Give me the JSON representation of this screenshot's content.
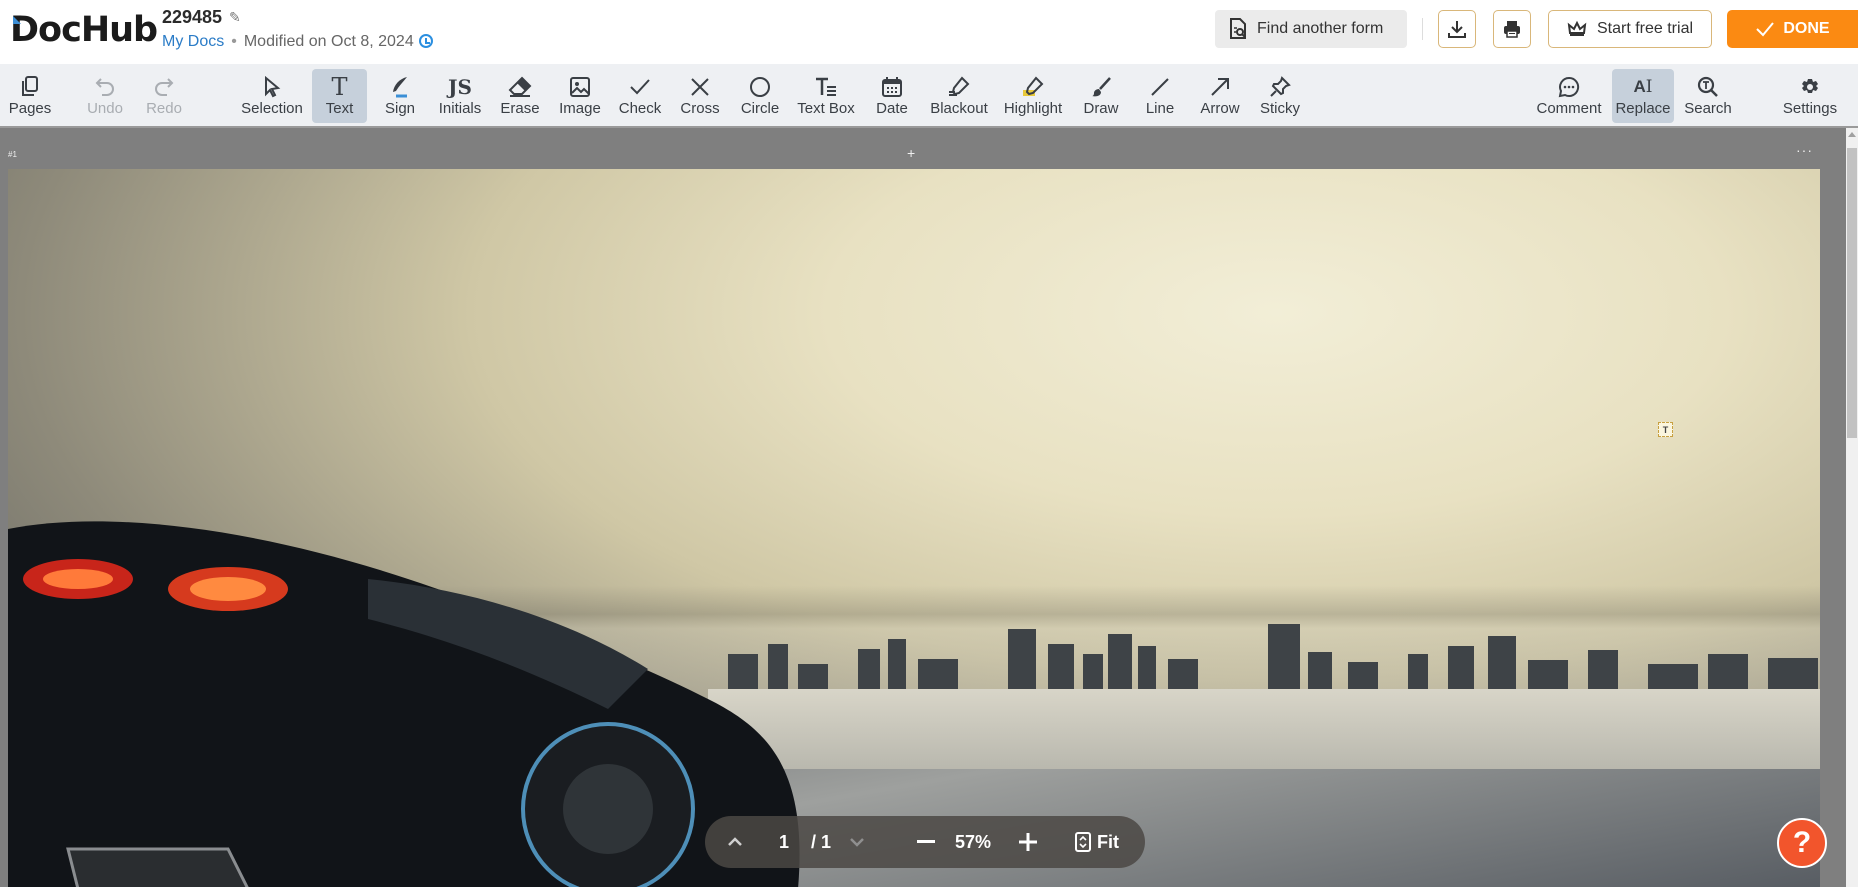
{
  "header": {
    "logo": "DocHub",
    "doc_title": "229485",
    "breadcrumb_link": "My Docs",
    "separator": "•",
    "modified": "Modified on Oct 8, 2024",
    "find_form": "Find another form",
    "start_trial": "Start free trial",
    "done": "DONE"
  },
  "toolbar": {
    "left": [
      {
        "id": "pages",
        "label": "Pages",
        "icon": "pages-icon"
      },
      {
        "id": "undo",
        "label": "Undo",
        "icon": "undo-icon",
        "disabled": true
      },
      {
        "id": "redo",
        "label": "Redo",
        "icon": "redo-icon",
        "disabled": true
      }
    ],
    "tools": [
      {
        "id": "selection",
        "label": "Selection",
        "icon": "cursor-icon"
      },
      {
        "id": "text",
        "label": "Text",
        "icon": "text-icon",
        "active": true
      },
      {
        "id": "sign",
        "label": "Sign",
        "icon": "quill-icon"
      },
      {
        "id": "initials",
        "label": "Initials",
        "icon": "initials-icon"
      },
      {
        "id": "erase",
        "label": "Erase",
        "icon": "eraser-icon"
      },
      {
        "id": "image",
        "label": "Image",
        "icon": "image-icon"
      },
      {
        "id": "check",
        "label": "Check",
        "icon": "check-icon"
      },
      {
        "id": "cross",
        "label": "Cross",
        "icon": "cross-icon"
      },
      {
        "id": "circle",
        "label": "Circle",
        "icon": "circle-icon"
      },
      {
        "id": "textbox",
        "label": "Text Box",
        "icon": "textbox-icon"
      },
      {
        "id": "date",
        "label": "Date",
        "icon": "calendar-icon"
      },
      {
        "id": "blackout",
        "label": "Blackout",
        "icon": "blackout-icon"
      },
      {
        "id": "highlight",
        "label": "Highlight",
        "icon": "highlighter-icon"
      },
      {
        "id": "draw",
        "label": "Draw",
        "icon": "brush-icon"
      },
      {
        "id": "line",
        "label": "Line",
        "icon": "line-icon"
      },
      {
        "id": "arrow",
        "label": "Arrow",
        "icon": "arrow-icon"
      },
      {
        "id": "sticky",
        "label": "Sticky",
        "icon": "pin-icon"
      }
    ],
    "right": [
      {
        "id": "comment",
        "label": "Comment",
        "icon": "comment-icon"
      },
      {
        "id": "replace",
        "label": "Replace",
        "icon": "replace-icon",
        "active": true
      },
      {
        "id": "search",
        "label": "Search",
        "icon": "search-icon"
      },
      {
        "id": "settings",
        "label": "Settings",
        "icon": "gear-icon"
      }
    ]
  },
  "canvas": {
    "page_label": "#1",
    "add_page": "+",
    "more": "···",
    "text_marker": "T"
  },
  "pager": {
    "current_page": "1",
    "total_pages": "/ 1",
    "zoom": "57%",
    "fit": "Fit"
  },
  "help": "?"
}
